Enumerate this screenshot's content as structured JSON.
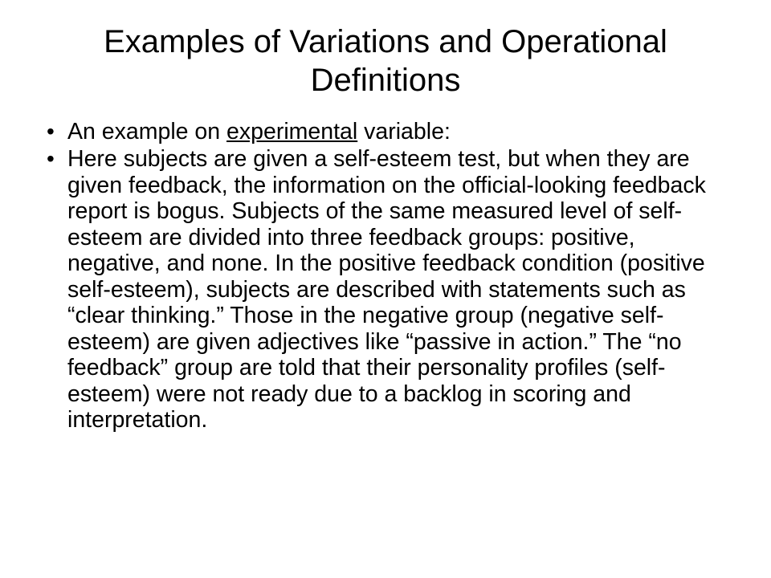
{
  "title": "Examples of Variations and Operational Definitions",
  "bullets": {
    "b1_pre": "An example on ",
    "b1_u": "experimental",
    "b1_post": " variable:",
    "b2": "Here subjects are given a self-esteem test, but when they are given feedback, the information on the official-looking feedback report is bogus. Subjects of the same measured level of self-esteem are divided into three feedback groups: positive, negative, and none. In the positive feedback condition (positive self-esteem), subjects are described with statements such as “clear thinking.” Those in the negative group (negative self-esteem) are given adjectives like “passive in action.” The “no feedback” group are told that their personality profiles (self-esteem) were not ready due to a backlog in scoring and interpretation."
  }
}
